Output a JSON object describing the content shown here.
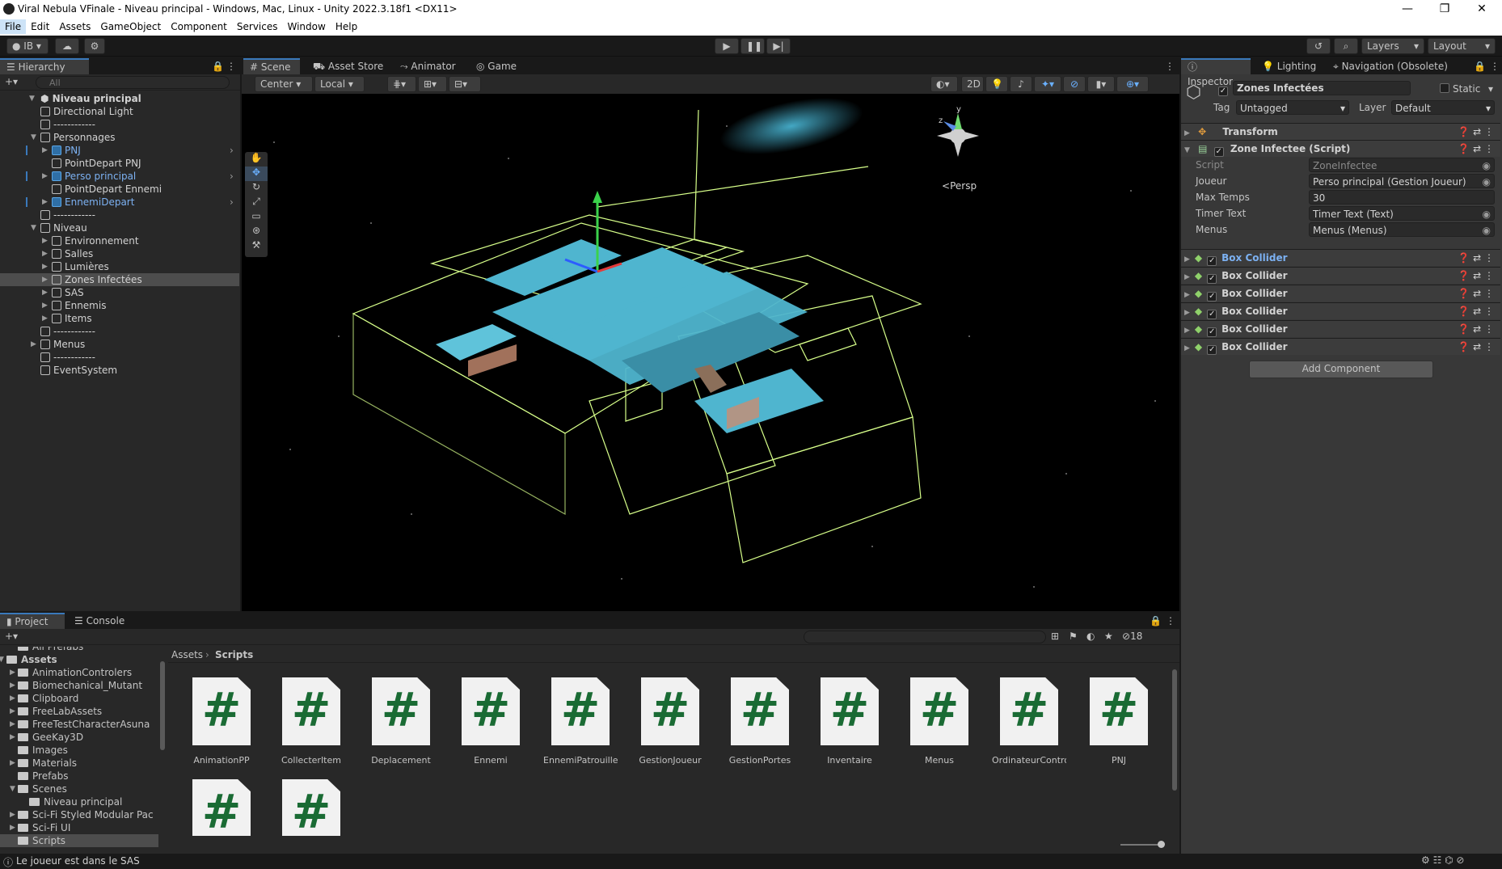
{
  "window": {
    "title": "Viral Nebula VFinale - Niveau principal - Windows, Mac, Linux - Unity 2022.3.18f1 <DX11>",
    "min": "—",
    "max": "❐",
    "close": "✕"
  },
  "menu": [
    "File",
    "Edit",
    "Assets",
    "GameObject",
    "Component",
    "Services",
    "Window",
    "Help"
  ],
  "toolbar": {
    "account": "IB",
    "layers": "Layers",
    "layout": "Layout"
  },
  "hierarchy": {
    "tab": "Hierarchy",
    "search_placeholder": "All",
    "scene": "Niveau principal",
    "items": [
      {
        "label": "Directional Light",
        "indent": 1,
        "type": "obj",
        "arrow": ""
      },
      {
        "label": "------------",
        "indent": 1,
        "type": "obj",
        "arrow": ""
      },
      {
        "label": "Personnages",
        "indent": 1,
        "type": "obj",
        "arrow": "▼"
      },
      {
        "label": "PNJ",
        "indent": 2,
        "type": "prefab",
        "arrow": "▶"
      },
      {
        "label": "PointDepart PNJ",
        "indent": 2,
        "type": "obj",
        "arrow": ""
      },
      {
        "label": "Perso principal",
        "indent": 2,
        "type": "prefab",
        "arrow": "▶"
      },
      {
        "label": "PointDepart Ennemi",
        "indent": 2,
        "type": "obj",
        "arrow": ""
      },
      {
        "label": "EnnemiDepart",
        "indent": 2,
        "type": "prefab",
        "arrow": "▶"
      },
      {
        "label": "------------",
        "indent": 1,
        "type": "obj",
        "arrow": ""
      },
      {
        "label": "Niveau",
        "indent": 1,
        "type": "obj",
        "arrow": "▼"
      },
      {
        "label": "Environnement",
        "indent": 2,
        "type": "obj",
        "arrow": "▶"
      },
      {
        "label": "Salles",
        "indent": 2,
        "type": "obj",
        "arrow": "▶"
      },
      {
        "label": "Lumières",
        "indent": 2,
        "type": "obj",
        "arrow": "▶"
      },
      {
        "label": "Zones Infectées",
        "indent": 2,
        "type": "obj",
        "arrow": "▶",
        "selected": true
      },
      {
        "label": "SAS",
        "indent": 2,
        "type": "obj",
        "arrow": "▶"
      },
      {
        "label": "Ennemis",
        "indent": 2,
        "type": "obj",
        "arrow": "▶"
      },
      {
        "label": "Items",
        "indent": 2,
        "type": "obj",
        "arrow": "▶"
      },
      {
        "label": "------------",
        "indent": 1,
        "type": "obj",
        "arrow": ""
      },
      {
        "label": "Menus",
        "indent": 1,
        "type": "obj",
        "arrow": "▶"
      },
      {
        "label": "------------",
        "indent": 1,
        "type": "obj",
        "arrow": ""
      },
      {
        "label": "EventSystem",
        "indent": 1,
        "type": "obj",
        "arrow": ""
      }
    ]
  },
  "scene_tabs": [
    "Scene",
    "Asset Store",
    "Animator",
    "Game"
  ],
  "scene_toolbar": {
    "pivot": "Center",
    "space": "Local",
    "mode2d": "2D"
  },
  "scene_view": {
    "projection": "Persp",
    "gizmo_y": "y",
    "gizmo_z": "z"
  },
  "inspector": {
    "tabs": [
      "Inspector",
      "Lighting",
      "Navigation (Obsolete)"
    ],
    "object_name": "Zones Infectées",
    "static": "Static",
    "tag_label": "Tag",
    "tag": "Untagged",
    "layer_label": "Layer",
    "layer": "Default",
    "transform": "Transform",
    "script_component": "Zone Infectee (Script)",
    "fields": [
      {
        "label": "Script",
        "value": "ZoneInfectee"
      },
      {
        "label": "Joueur",
        "value": "Perso principal (Gestion Joueur)"
      },
      {
        "label": "Max Temps",
        "value": "30"
      },
      {
        "label": "Timer Text",
        "value": "Timer Text (Text)"
      },
      {
        "label": "Menus",
        "value": "Menus (Menus)"
      }
    ],
    "box_colliders": [
      "Box Collider",
      "Box Collider",
      "Box Collider",
      "Box Collider",
      "Box Collider",
      "Box Collider"
    ],
    "add_component": "Add Component"
  },
  "project": {
    "tabs": [
      "Project",
      "Console"
    ],
    "breadcrumb": [
      "Assets",
      "Scripts"
    ],
    "hidden_count": "18",
    "tree": [
      {
        "label": "All Prefabs",
        "indent": 1
      },
      {
        "label": "Assets",
        "indent": 0,
        "bold": true,
        "arrow": "▼"
      },
      {
        "label": "AnimationControlers",
        "indent": 1,
        "arrow": "▶"
      },
      {
        "label": "Biomechanical_Mutant",
        "indent": 1,
        "arrow": "▶"
      },
      {
        "label": "Clipboard",
        "indent": 1,
        "arrow": "▶"
      },
      {
        "label": "FreeLabAssets",
        "indent": 1,
        "arrow": "▶"
      },
      {
        "label": "FreeTestCharacterAsuna",
        "indent": 1,
        "arrow": "▶"
      },
      {
        "label": "GeeKay3D",
        "indent": 1,
        "arrow": "▶"
      },
      {
        "label": "Images",
        "indent": 1,
        "arrow": ""
      },
      {
        "label": "Materials",
        "indent": 1,
        "arrow": "▶"
      },
      {
        "label": "Prefabs",
        "indent": 1,
        "arrow": ""
      },
      {
        "label": "Scenes",
        "indent": 1,
        "arrow": "▼"
      },
      {
        "label": "Niveau principal",
        "indent": 2,
        "arrow": ""
      },
      {
        "label": "Sci-Fi Styled Modular Pac",
        "indent": 1,
        "arrow": "▶"
      },
      {
        "label": "Sci-Fi UI",
        "indent": 1,
        "arrow": "▶"
      },
      {
        "label": "Scripts",
        "indent": 1,
        "arrow": "",
        "selected": true
      }
    ],
    "assets": [
      "AnimationPP",
      "CollecterItem",
      "Deplacement",
      "Ennemi",
      "EnnemiPatrouille",
      "GestionJoueur",
      "GestionPortes",
      "Inventaire",
      "Menus",
      "OrdinateurContro...",
      "PNJ",
      "",
      ""
    ]
  },
  "status": {
    "message": "Le joueur est dans le SAS"
  },
  "colors": {
    "accent": "#3a79bb",
    "grid": "#d7ff8a",
    "floor": "#4fb5cf"
  }
}
